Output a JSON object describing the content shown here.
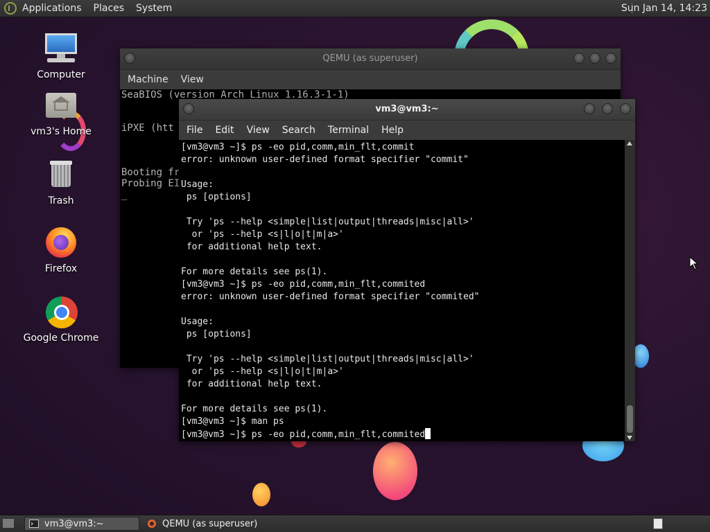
{
  "top_panel": {
    "menus": [
      "Applications",
      "Places",
      "System"
    ],
    "clock": "Sun Jan 14, 14:23"
  },
  "desktop_icons": [
    {
      "label": "Computer",
      "icon": "computer-icon"
    },
    {
      "label": "vm3's Home",
      "icon": "home-folder-icon"
    },
    {
      "label": "Trash",
      "icon": "trash-icon"
    },
    {
      "label": "Firefox",
      "icon": "firefox-icon"
    },
    {
      "label": "Google Chrome",
      "icon": "chrome-icon"
    }
  ],
  "qemu_window": {
    "title": "QEMU (as superuser)",
    "menus": [
      "Machine",
      "View"
    ],
    "screen_lines": [
      "SeaBIOS (version Arch Linux 1.16.3-1-1)",
      "iPXE (htt",
      "Booting fr",
      "Probing EI",
      "_"
    ]
  },
  "terminal_window": {
    "title": "vm3@vm3:~",
    "menus": [
      "File",
      "Edit",
      "View",
      "Search",
      "Terminal",
      "Help"
    ],
    "lines": [
      "[vm3@vm3 ~]$ ps -eo pid,comm,min_flt,commit",
      "error: unknown user-defined format specifier \"commit\"",
      "",
      "Usage:",
      " ps [options]",
      "",
      " Try 'ps --help <simple|list|output|threads|misc|all>'",
      "  or 'ps --help <s|l|o|t|m|a>'",
      " for additional help text.",
      "",
      "For more details see ps(1).",
      "[vm3@vm3 ~]$ ps -eo pid,comm,min_flt,commited",
      "error: unknown user-defined format specifier \"commited\"",
      "",
      "Usage:",
      " ps [options]",
      "",
      " Try 'ps --help <simple|list|output|threads|misc|all>'",
      "  or 'ps --help <s|l|o|t|m|a>'",
      " for additional help text.",
      "",
      "For more details see ps(1).",
      "[vm3@vm3 ~]$ man ps",
      "[vm3@vm3 ~]$ ps -eo pid,comm,min_flt,commited"
    ]
  },
  "taskbar": {
    "tasks": [
      {
        "label": "vm3@vm3:~",
        "icon": "terminal-icon",
        "active": true
      },
      {
        "label": "QEMU (as superuser)",
        "icon": "qemu-icon",
        "active": false
      }
    ]
  },
  "colors": {
    "panel": "#333333",
    "wallpaper": "#2a1430",
    "terminal_bg": "#000000",
    "terminal_fg": "#e8e8e8"
  }
}
